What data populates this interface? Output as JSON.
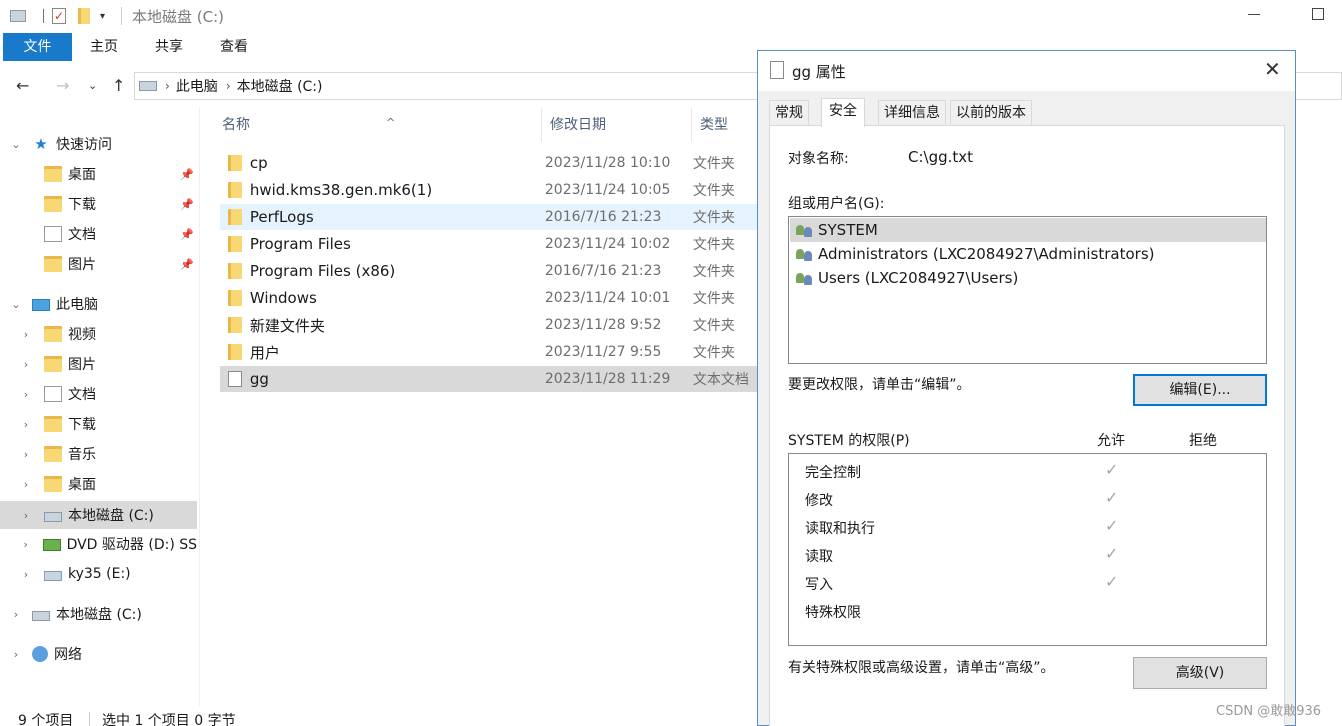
{
  "window": {
    "title": "本地磁盘 (C:)"
  },
  "ribbon": {
    "tabs": [
      "文件",
      "主页",
      "共享",
      "查看"
    ]
  },
  "address": {
    "crumbs": [
      "此电脑",
      "本地磁盘 (C:)"
    ]
  },
  "nav": {
    "items": [
      {
        "label": "快速访问",
        "icon": "star-icon"
      },
      {
        "label": "桌面",
        "icon": "folder-icon",
        "pinned": true
      },
      {
        "label": "下载",
        "icon": "folder-icon",
        "pinned": true
      },
      {
        "label": "文档",
        "icon": "document-icon",
        "pinned": true
      },
      {
        "label": "图片",
        "icon": "folder-icon",
        "pinned": true
      },
      {
        "label": "此电脑",
        "icon": "computer-icon"
      },
      {
        "label": "视频",
        "icon": "folder-icon"
      },
      {
        "label": "图片",
        "icon": "folder-icon"
      },
      {
        "label": "文档",
        "icon": "document-icon"
      },
      {
        "label": "下载",
        "icon": "folder-icon"
      },
      {
        "label": "音乐",
        "icon": "folder-icon"
      },
      {
        "label": "桌面",
        "icon": "folder-icon"
      },
      {
        "label": "本地磁盘 (C:)",
        "icon": "drive-icon",
        "selected": true
      },
      {
        "label": "DVD 驱动器 (D:) SS",
        "icon": "dvd-icon"
      },
      {
        "label": "ky35 (E:)",
        "icon": "drive-icon"
      },
      {
        "label": "本地磁盘 (C:)",
        "icon": "drive-icon"
      },
      {
        "label": "网络",
        "icon": "network-icon"
      }
    ]
  },
  "filelist": {
    "columns": [
      "名称",
      "修改日期",
      "类型"
    ],
    "rows": [
      {
        "name": "cp",
        "date": "2023/11/28 10:10",
        "type": "文件夹",
        "kind": "folder"
      },
      {
        "name": "hwid.kms38.gen.mk6(1)",
        "date": "2023/11/24 10:05",
        "type": "文件夹",
        "kind": "folder"
      },
      {
        "name": "PerfLogs",
        "date": "2016/7/16 21:23",
        "type": "文件夹",
        "kind": "folder"
      },
      {
        "name": "Program Files",
        "date": "2023/11/24 10:02",
        "type": "文件夹",
        "kind": "folder"
      },
      {
        "name": "Program Files (x86)",
        "date": "2016/7/16 21:23",
        "type": "文件夹",
        "kind": "folder"
      },
      {
        "name": "Windows",
        "date": "2023/11/24 10:01",
        "type": "文件夹",
        "kind": "folder"
      },
      {
        "name": "新建文件夹",
        "date": "2023/11/28 9:52",
        "type": "文件夹",
        "kind": "folder"
      },
      {
        "name": "用户",
        "date": "2023/11/27 9:55",
        "type": "文件夹",
        "kind": "folder"
      },
      {
        "name": "gg",
        "date": "2023/11/28 11:29",
        "type": "文本文档",
        "kind": "txt"
      }
    ]
  },
  "status": {
    "count": "9 个项目",
    "selection": "选中 1 个项目  0 字节"
  },
  "dialog": {
    "title": "gg 属性",
    "tabs": [
      "常规",
      "安全",
      "详细信息",
      "以前的版本"
    ],
    "object_label": "对象名称:",
    "object_value": "C:\\gg.txt",
    "group_label": "组或用户名(G):",
    "users": [
      "SYSTEM",
      "Administrators (LXC2084927\\Administrators)",
      "Users (LXC2084927\\Users)"
    ],
    "edit_hint": "要更改权限，请单击“编辑”。",
    "edit_button": "编辑(E)...",
    "perm_title": "SYSTEM 的权限(P)",
    "allow_label": "允许",
    "deny_label": "拒绝",
    "permissions": [
      {
        "name": "完全控制",
        "allow": true
      },
      {
        "name": "修改",
        "allow": true
      },
      {
        "name": "读取和执行",
        "allow": true
      },
      {
        "name": "读取",
        "allow": true
      },
      {
        "name": "写入",
        "allow": true
      },
      {
        "name": "特殊权限",
        "allow": false
      }
    ],
    "advanced_hint": "有关特殊权限或高级设置，请单击“高级”。",
    "advanced_button": "高级(V)"
  },
  "watermark": "CSDN @敢敢936"
}
